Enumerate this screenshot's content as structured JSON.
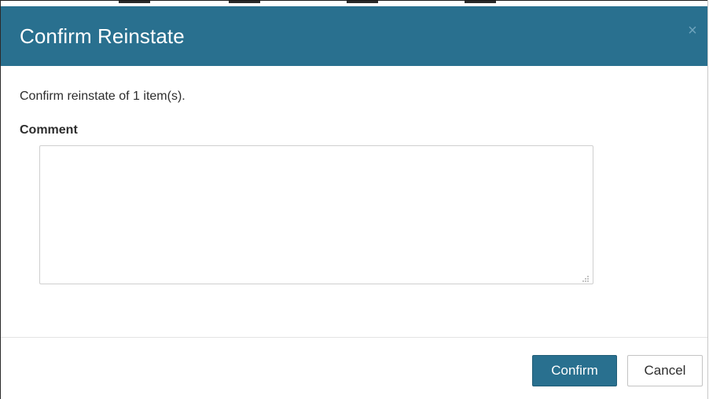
{
  "dialog": {
    "title": "Confirm Reinstate",
    "close_icon": "close-icon",
    "message": "Confirm reinstate of 1 item(s).",
    "comment": {
      "label": "Comment",
      "value": "",
      "placeholder": ""
    },
    "buttons": {
      "confirm_label": "Confirm",
      "cancel_label": "Cancel"
    }
  },
  "colors": {
    "header_bg": "#29708f",
    "primary_button": "#29708f",
    "text": "#2d2d2d"
  }
}
